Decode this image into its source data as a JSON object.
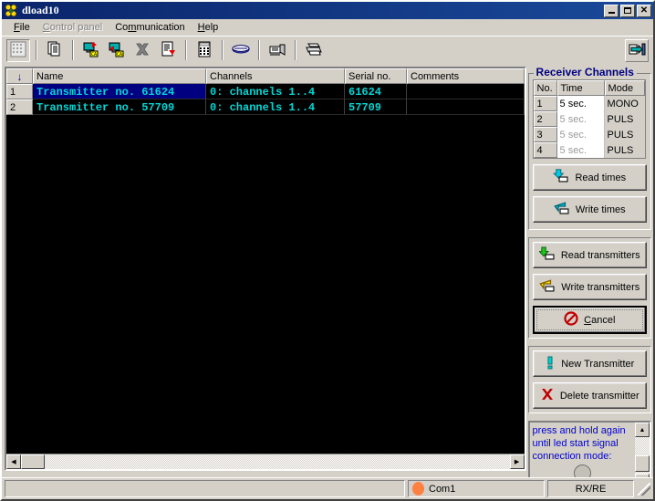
{
  "window": {
    "title": "dload10",
    "icon": "app-icon",
    "buttons": {
      "minimize": "_",
      "maximize": "□",
      "close": "✕"
    }
  },
  "menu": {
    "items": [
      {
        "label": "File",
        "disabled": false
      },
      {
        "label": "Control panel",
        "disabled": true
      },
      {
        "label": "Communication",
        "disabled": false
      },
      {
        "label": "Help",
        "disabled": false
      }
    ]
  },
  "toolbar": {
    "items": [
      {
        "name": "grid-view-icon",
        "state": "pressed"
      },
      {
        "sep": true
      },
      {
        "name": "copy-pages-icon",
        "state": "normal"
      },
      {
        "sep": true
      },
      {
        "name": "read-channels-icon",
        "state": "normal"
      },
      {
        "name": "write-channels-icon",
        "state": "normal"
      },
      {
        "name": "delete-x-icon",
        "state": "normal"
      },
      {
        "name": "edit-document-icon",
        "state": "normal"
      },
      {
        "sep": true
      },
      {
        "name": "calculator-icon",
        "state": "normal"
      },
      {
        "sep": true
      },
      {
        "name": "device-icon",
        "state": "normal"
      },
      {
        "sep": true
      },
      {
        "name": "transmitter-icon",
        "state": "normal"
      },
      {
        "sep": true
      },
      {
        "name": "printer-icon",
        "state": "normal"
      }
    ],
    "right_button": {
      "name": "exit-icon"
    }
  },
  "transmitter_list": {
    "columns": [
      "",
      "Name",
      "Channels",
      "Serial no.",
      "Comments"
    ],
    "sort_column_index": 0,
    "sort_glyph": "↓",
    "rows": [
      {
        "num": "1",
        "name": "Transmitter no. 61624",
        "channels": "0: channels 1..4",
        "serial": "61624",
        "comments": "",
        "selected": true
      },
      {
        "num": "2",
        "name": "Transmitter no. 57709",
        "channels": "0: channels 1..4",
        "serial": "57709",
        "comments": "",
        "selected": false
      }
    ],
    "hscroll": {
      "left_glyph": "◀",
      "right_glyph": "▶"
    }
  },
  "receiver_channels": {
    "title": "Receiver Channels",
    "columns": [
      "No.",
      "Time",
      "Mode"
    ],
    "rows": [
      {
        "no": "1",
        "time": "5 sec.",
        "mode": "MONO",
        "dim": false
      },
      {
        "no": "2",
        "time": "5 sec.",
        "mode": "PULS",
        "dim": true
      },
      {
        "no": "3",
        "time": "5 sec.",
        "mode": "PULS",
        "dim": true
      },
      {
        "no": "4",
        "time": "5 sec.",
        "mode": "PULS",
        "dim": true
      }
    ],
    "buttons": [
      {
        "label": "Read times",
        "icon": "read-times-icon"
      },
      {
        "label": "Write times",
        "icon": "write-times-icon"
      }
    ]
  },
  "transmitter_actions": {
    "buttons": [
      {
        "label": "Read transmitters",
        "icon": "read-transmitters-icon"
      },
      {
        "label": "Write transmitters",
        "icon": "write-transmitters-icon"
      },
      {
        "label": "Cancel",
        "icon": "cancel-icon",
        "default": true
      }
    ]
  },
  "transmitter_manage": {
    "buttons": [
      {
        "label": "New Transmitter",
        "icon": "new-transmitter-icon"
      },
      {
        "label": "Delete transmitter",
        "icon": "delete-transmitter-icon"
      }
    ]
  },
  "status_memo": {
    "lines": [
      "press and hold again",
      "until led start signal",
      "connection mode:"
    ],
    "led": "status-led",
    "scroll": {
      "up_glyph": "▲",
      "down_glyph": "▼"
    }
  },
  "statusbar": {
    "message": "",
    "port": "Com1",
    "port_led_color": "#ff8040",
    "mode": "RX/RE"
  },
  "colors": {
    "face": "#d4d0c8",
    "title_active": "#0a246a",
    "grid_text": "#00d8d8",
    "grid_bg": "#000000",
    "selection": "#000080",
    "group_title": "#000080",
    "memo_text": "#0000cc",
    "led_orange": "#ff8040"
  }
}
